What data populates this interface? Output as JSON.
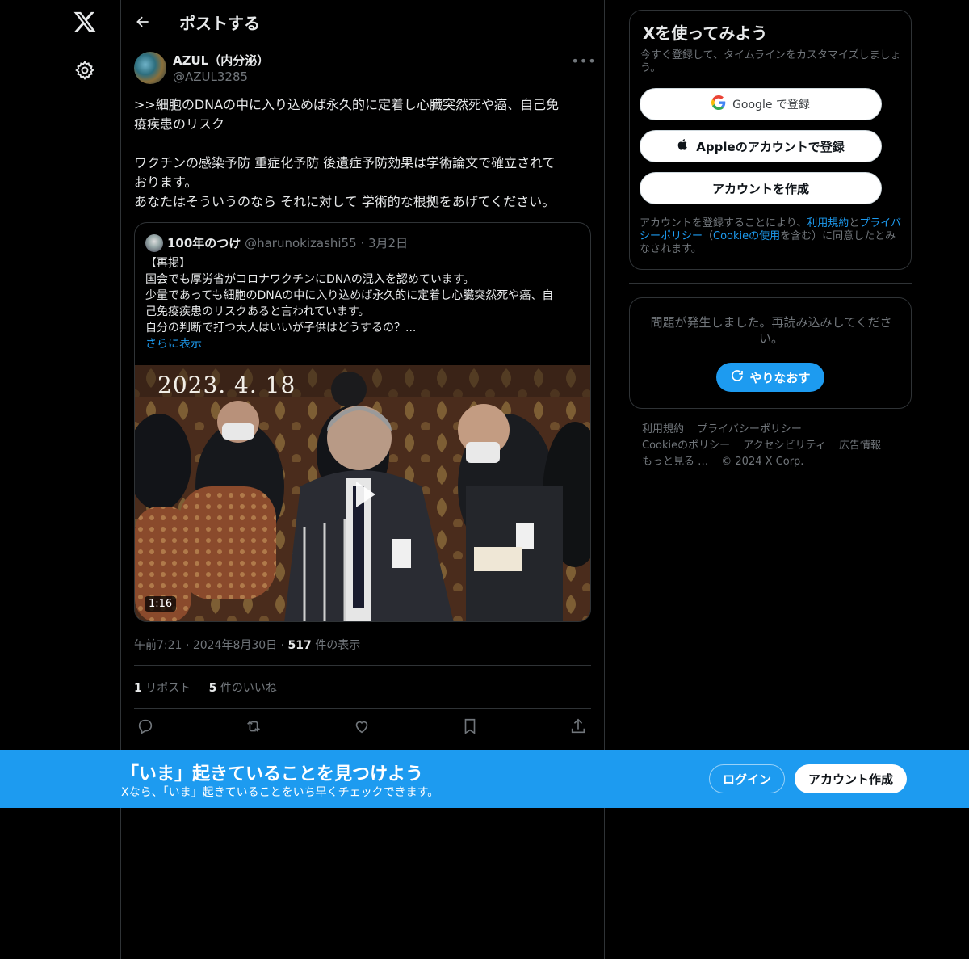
{
  "nav": {
    "logo_icon": "x-logo-icon",
    "settings_icon": "gear-icon"
  },
  "header": {
    "title": "ポストする"
  },
  "post": {
    "author_name": "AZUL（内分泌）",
    "author_handle": "@AZUL3285",
    "more_glyph": "•••",
    "body_lines": [
      ">>細胞のDNAの中に入り込めば永久的に定着し心臓突然死や癌、自己免",
      "疫疾患のリスク",
      "",
      "ワクチンの感染予防 重症化予防 後遺症予防効果は学術論文で確立されて",
      "おります。",
      "あなたはそういうのなら それに対して 学術的な根拠をあげてください。"
    ],
    "time": "午前7:21",
    "date": "2024年8月30日",
    "views_count": "517",
    "views_label": "件の表示",
    "reposts_count": "1",
    "reposts_label": "リポスト",
    "likes_count": "5",
    "likes_label": "件のいいね",
    "sep": "·"
  },
  "quote": {
    "name": "100年のつけ",
    "handle": "@harunokizashi55",
    "date": "3月2日",
    "sep": "·",
    "lines": [
      "【再掲】",
      "国会でも厚労省がコロナワクチンにDNAの混入を認めています。",
      "少量であっても細胞のDNAの中に入り込めば永久的に定着し心臓突然死や癌、自",
      "己免疫疾患のリスクあると言われています。",
      "自分の判断で打つ大人はいいが子供はどうするの？..."
    ],
    "show_more": "さらに表示",
    "media_date_text": "2023. 4. 18",
    "duration": "1:16"
  },
  "sidebar": {
    "signup_title": "Xを使ってみよう",
    "signup_sub": "今すぐ登録して、タイムラインをカスタマイズしましょう。",
    "google_label": "Google で登録",
    "apple_label": "Appleのアカウントで登録",
    "create_label": "アカウントを作成",
    "terms_prefix": "アカウントを登録することにより、",
    "terms_link": "利用規約",
    "terms_and": "と",
    "privacy_link": "プライバシーポリシー",
    "terms_paren_open": "（",
    "cookie_link": "Cookieの使用",
    "terms_suffix": "を含む）に同意したとみなされます。",
    "error_text": "問題が発生しました。再読み込みしてください。",
    "retry_label": "やりなおす",
    "footer": [
      "利用規約",
      "プライバシーポリシー",
      "Cookieのポリシー",
      "アクセシビリティ",
      "広告情報",
      "もっと見る …",
      "© 2024 X Corp."
    ]
  },
  "banner": {
    "title": "「いま」起きていることを見つけよう",
    "subtitle": "Xなら、「いま」起きていることをいち早くチェックできます。",
    "login_label": "ログイン",
    "create_label": "アカウント作成"
  },
  "colors": {
    "accent": "#1d9bf0",
    "background": "#000000",
    "border": "#2f3336",
    "muted": "#71767b"
  }
}
